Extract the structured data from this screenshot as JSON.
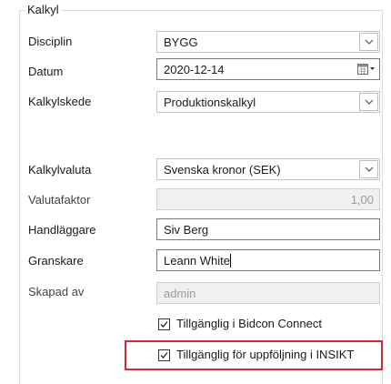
{
  "group": {
    "title": "Kalkyl"
  },
  "fields": {
    "disciplin": {
      "label": "Disciplin",
      "value": "BYGG"
    },
    "datum": {
      "label": "Datum",
      "value": "2020-12-14"
    },
    "kalkylskede": {
      "label": "Kalkylskede",
      "value": "Produktionskalkyl"
    },
    "kalkylvaluta": {
      "label": "Kalkylvaluta",
      "value": "Svenska kronor (SEK)"
    },
    "valutafaktor": {
      "label": "Valutafaktor",
      "value": "1,00"
    },
    "handlaggare": {
      "label": "Handläggare",
      "value": "Siv Berg"
    },
    "granskare": {
      "label": "Granskare",
      "value": "Leann White"
    },
    "skapad_av": {
      "label": "Skapad av",
      "value": "admin"
    }
  },
  "checkboxes": {
    "bidcon": {
      "label": "Tillgänglig i Bidcon Connect",
      "checked": true
    },
    "insikt": {
      "label": "Tillgänglig för uppföljning i INSIKT",
      "checked": true
    }
  },
  "colors": {
    "highlight": "#e0252d",
    "disabled_bg": "#f0f0f0"
  },
  "icons": [
    "chevron-down-icon",
    "calendar-icon",
    "checkmark-icon"
  ]
}
